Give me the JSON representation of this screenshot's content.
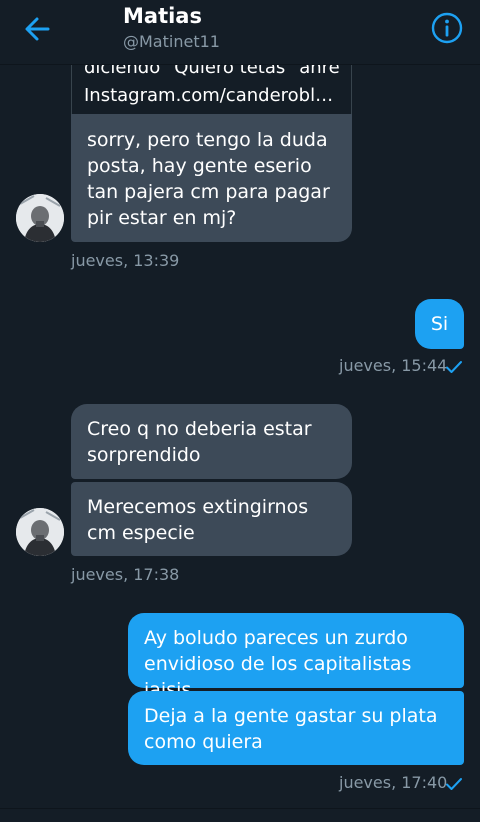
{
  "header": {
    "name": "Matias",
    "handle": "@Matinet11"
  },
  "link_preview": {
    "line1": "diciendo \"Quiero tetas\" anre",
    "line2": "Instagram.com/canderoblesss"
  },
  "messages": [
    {
      "side": "in",
      "text": "sorry, pero tengo la duda posta, hay gente eserio tan pajera cm para pagar pir estar en mj?"
    },
    {
      "side": "out",
      "text": "Si"
    },
    {
      "side": "in",
      "text": "Creo q no deberia estar sorprendido"
    },
    {
      "side": "in",
      "text": "Merecemos extingirnos cm especie"
    },
    {
      "side": "out",
      "text": "Ay boludo pareces un zurdo envidioso de los capitalistas jajsjs"
    },
    {
      "side": "out",
      "text": "Deja a la gente gastar su plata como quiera"
    }
  ],
  "timestamps": [
    "jueves, 13:39",
    "jueves, 15:44",
    "jueves, 17:38",
    "jueves, 17:40"
  ],
  "colors": {
    "background": "#141d26",
    "incoming_bubble": "#3d4a58",
    "outgoing_bubble": "#1da1f2",
    "accent": "#1da1f2",
    "muted_text": "#8899a6"
  },
  "icons": {
    "back": "arrow-left-icon",
    "info": "info-icon",
    "read": "checkmark-icon"
  }
}
